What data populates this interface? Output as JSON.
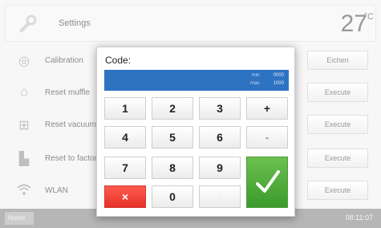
{
  "header": {
    "title": "Settings",
    "temperature": "27",
    "unit": "°C"
  },
  "rows": [
    {
      "label": "Calibration",
      "button": "Eichen"
    },
    {
      "label": "Reset muffle",
      "button": "Execute"
    },
    {
      "label": "Reset vacuum",
      "button": "Execute"
    },
    {
      "label": "Reset to factory",
      "button": "Execute"
    },
    {
      "label": "WLAN",
      "button": "Execute"
    }
  ],
  "footer": {
    "home": "Home",
    "time": "08:11:07"
  },
  "dialog": {
    "title": "Code:",
    "display": {
      "line1_label": "min.",
      "line1_value": "0000",
      "line2_label": "max.",
      "line2_value": "1000"
    },
    "keys": {
      "k1": "1",
      "k2": "2",
      "k3": "3",
      "plus": "+",
      "k4": "4",
      "k5": "5",
      "k6": "6",
      "minus": "-",
      "k7": "7",
      "k8": "8",
      "k9": "9",
      "delete": "×",
      "k0": "0",
      "dot": "."
    },
    "colors": {
      "display": "#2e72c2",
      "delete": "#e53226",
      "ok": "#4aa835"
    }
  }
}
